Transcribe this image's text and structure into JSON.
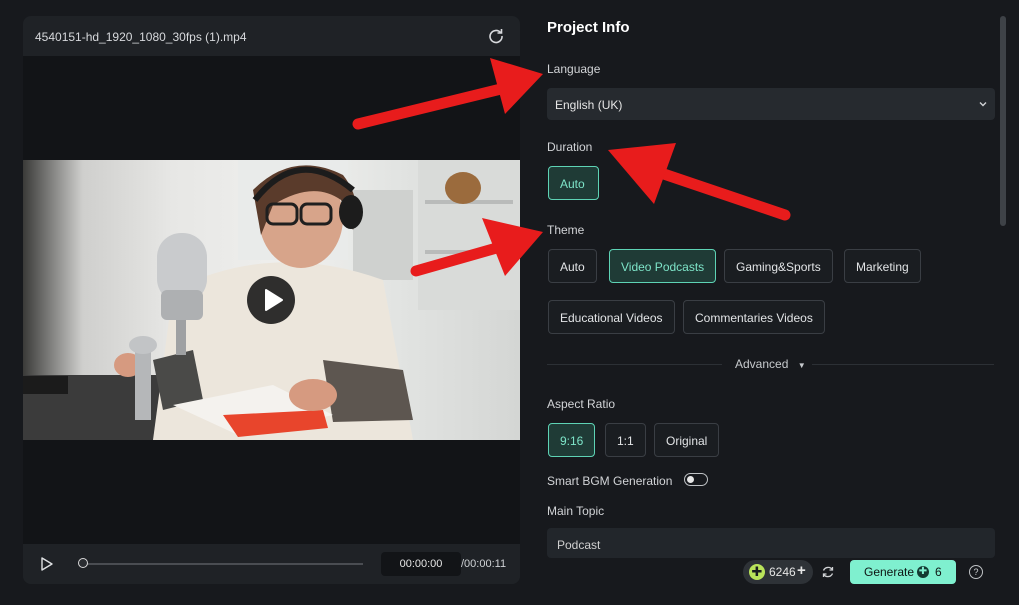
{
  "preview": {
    "file_name": "4540151-hd_1920_1080_30fps (1).mp4",
    "time_current": "00:00:00",
    "time_total": "/00:00:11"
  },
  "panel": {
    "title": "Project Info",
    "language_label": "Language",
    "language_value": "English (UK)",
    "duration_label": "Duration",
    "duration_options": [
      "Auto"
    ],
    "duration_selected": "Auto",
    "theme_label": "Theme",
    "theme_options": [
      "Auto",
      "Video Podcasts",
      "Gaming&Sports",
      "Marketing",
      "Educational Videos",
      "Commentaries Videos"
    ],
    "theme_selected": "Video Podcasts",
    "advanced_label": "Advanced",
    "aspect_label": "Aspect Ratio",
    "aspect_options": [
      "9:16",
      "1:1",
      "Original"
    ],
    "aspect_selected": "9:16",
    "smart_bgm_label": "Smart BGM Generation",
    "smart_bgm_on": false,
    "main_topic_label": "Main Topic",
    "main_topic_value": "Podcast"
  },
  "footer": {
    "credits": "6246",
    "generate_label": "Generate",
    "generate_cost": "6",
    "help_symbol": "?"
  },
  "colors": {
    "accent": "#7ff0cf",
    "selected_border": "#5ed3b5",
    "annotation_arrow": "#e81c1c"
  },
  "icons": [
    "reset-icon",
    "play-icon",
    "chevron-down-icon",
    "caret-down-icon",
    "refresh-icon",
    "help-icon",
    "credit-icon",
    "plus-icon"
  ]
}
